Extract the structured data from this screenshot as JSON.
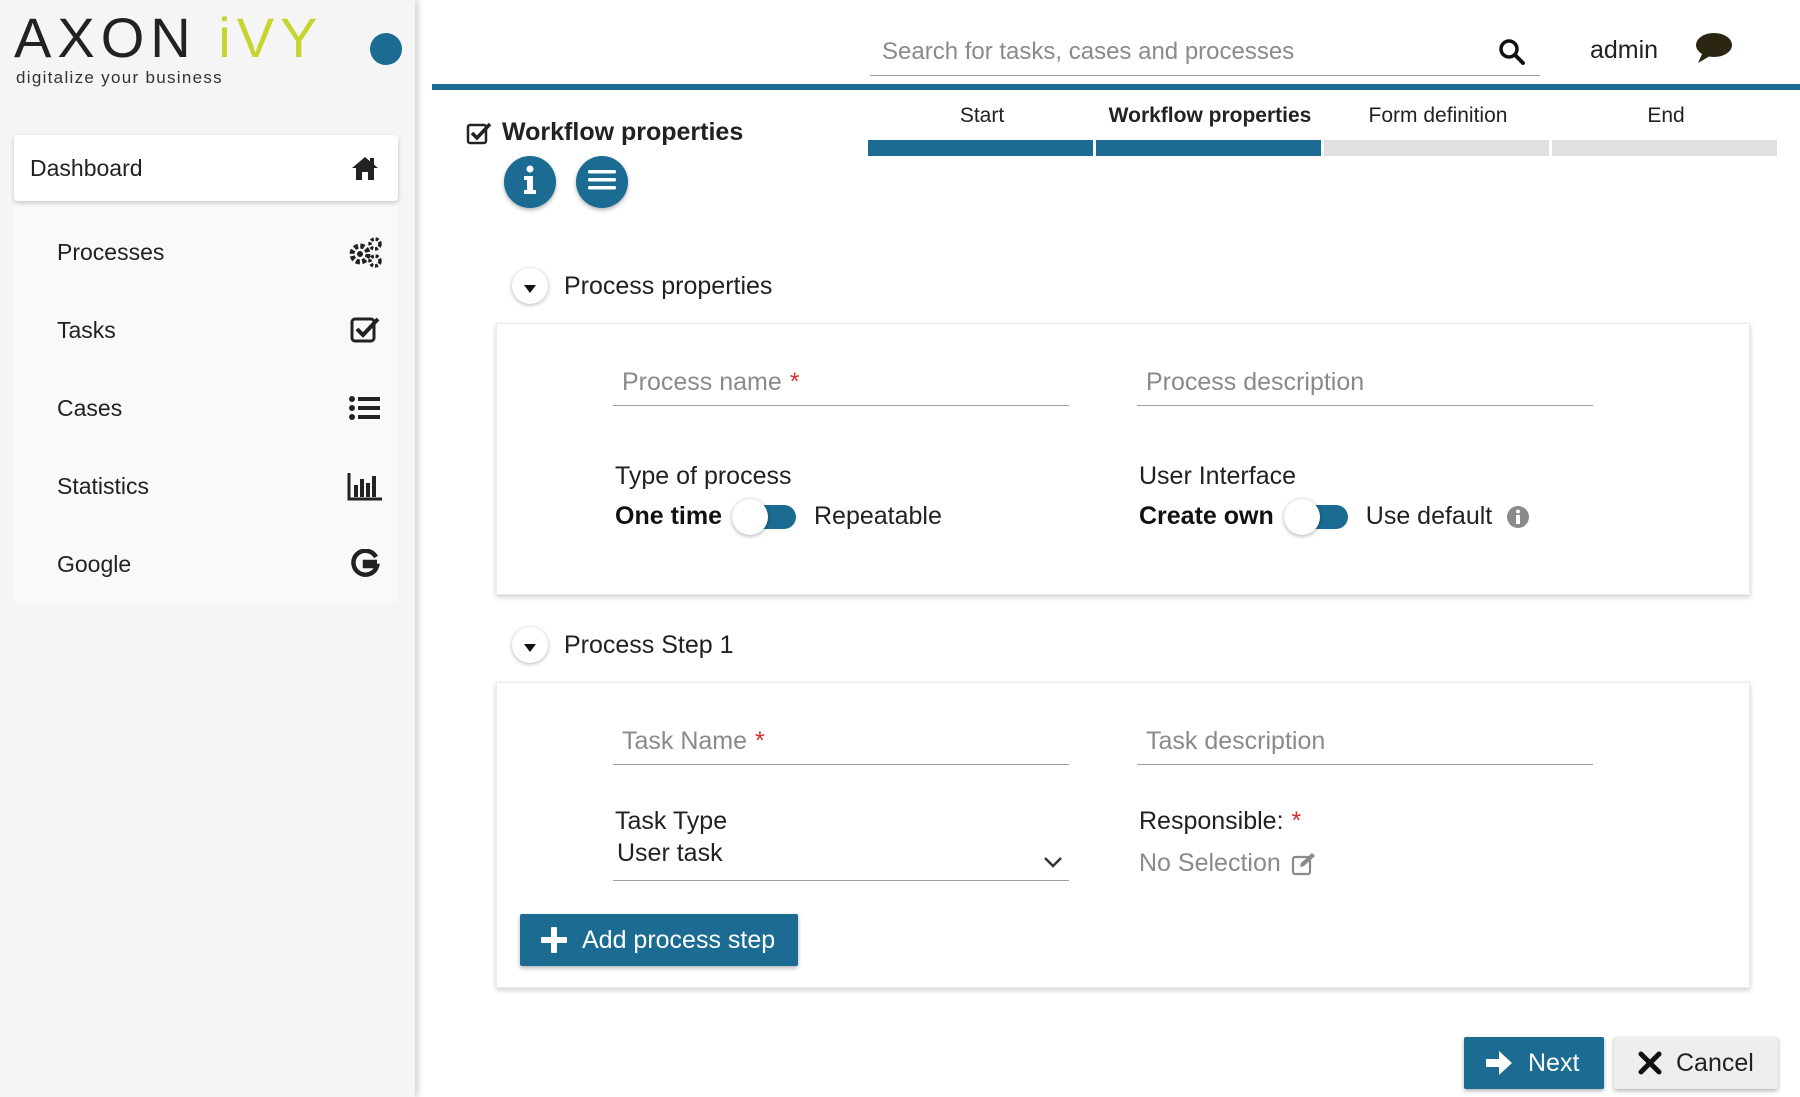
{
  "brand": {
    "logo_part1": "AXON ",
    "logo_part2": "iVY",
    "tagline": "digitalize your business",
    "accent_color": "#1b6b92",
    "logo_accent_color": "#c5d52d"
  },
  "sidebar": {
    "items": [
      {
        "label": "Dashboard",
        "icon": "home-icon",
        "active": true
      },
      {
        "label": "Processes",
        "icon": "gears-icon"
      },
      {
        "label": "Tasks",
        "icon": "check-square-icon"
      },
      {
        "label": "Cases",
        "icon": "list-icon"
      },
      {
        "label": "Statistics",
        "icon": "bar-chart-icon"
      },
      {
        "label": "Google",
        "icon": "google-icon"
      }
    ]
  },
  "header": {
    "search_placeholder": "Search for tasks, cases and processes",
    "user_name": "admin"
  },
  "page": {
    "title": "Workflow properties"
  },
  "steps": [
    {
      "label": "Start",
      "state": "done"
    },
    {
      "label": "Workflow properties",
      "state": "current"
    },
    {
      "label": "Form definition",
      "state": "todo"
    },
    {
      "label": "End",
      "state": "todo"
    }
  ],
  "process_properties": {
    "legend": "Process properties",
    "name_placeholder": "Process name",
    "required_mark": "*",
    "description_placeholder": "Process description",
    "type_label": "Type of process",
    "type_on": "One time",
    "type_off": "Repeatable",
    "ui_label": "User Interface",
    "ui_on": "Create own",
    "ui_off": "Use default"
  },
  "process_step": {
    "legend": "Process Step 1",
    "task_name_placeholder": "Task Name",
    "required_mark": "*",
    "task_description_placeholder": "Task description",
    "task_type_label": "Task Type",
    "task_type_value": "User task",
    "responsible_label": "Responsible:",
    "responsible_value": "No Selection"
  },
  "actions": {
    "add_step": "Add process step",
    "next": "Next",
    "cancel": "Cancel"
  }
}
